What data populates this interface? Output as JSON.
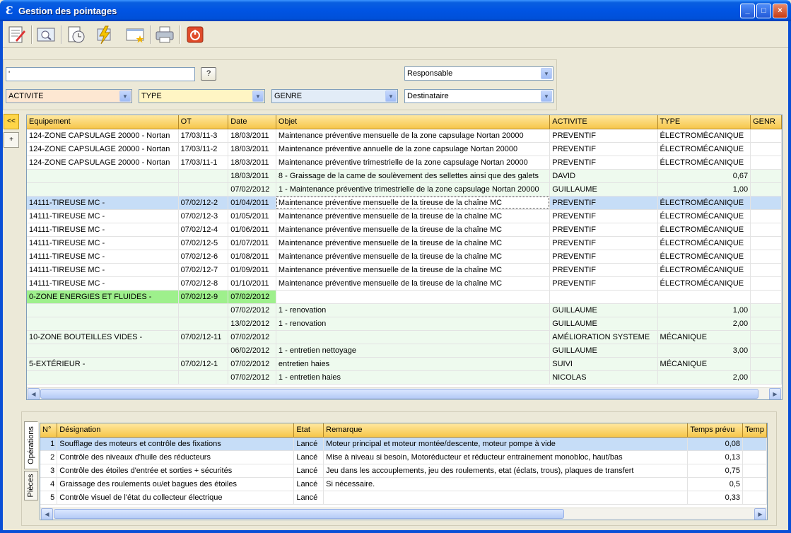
{
  "window": {
    "icon_glyph": "Ɛ",
    "title": "Gestion des pointages",
    "controls": [
      "_",
      "□",
      "×"
    ]
  },
  "toolbar": {
    "buttons": [
      {
        "name": "edit-document-icon"
      },
      {
        "name": "search-view-icon"
      },
      {
        "name": "schedule-clock-icon"
      },
      {
        "name": "lightning-icon"
      },
      {
        "name": "calendar-star-icon"
      },
      {
        "name": "print-icon"
      },
      {
        "name": "power-exit-icon"
      }
    ]
  },
  "filters": {
    "search_value": "'",
    "help_label": "?",
    "responsable": "Responsable",
    "activite": "ACTIVITE",
    "type": "TYPE",
    "genre": "GENRE",
    "destinataire": "Destinataire",
    "colors": {
      "activite": "#fde7d2",
      "type": "#fff5c4",
      "genre": "#e2ecf7"
    }
  },
  "nav": {
    "collapse_label": "<<",
    "add_label": "+"
  },
  "main_grid": {
    "columns": [
      "Equipement",
      "OT",
      "Date",
      "Objet",
      "ACTIVITE",
      "TYPE",
      "GENR"
    ],
    "rows": [
      {
        "equipement": "124-ZONE CAPSULAGE 20000 - Nortan",
        "ot": "17/03/11-3",
        "date": "18/03/2011",
        "objet": "Maintenance préventive mensuelle de la zone capsulage Nortan 20000",
        "activite": "PREVENTIF",
        "type": "ÉLECTROMÉCANIQUE",
        "genre": "",
        "style": ""
      },
      {
        "equipement": "124-ZONE CAPSULAGE 20000 - Nortan",
        "ot": "17/03/11-2",
        "date": "18/03/2011",
        "objet": "Maintenance préventive annuelle de la zone capsulage Nortan 20000",
        "activite": "PREVENTIF",
        "type": "ÉLECTROMÉCANIQUE",
        "genre": "",
        "style": ""
      },
      {
        "equipement": "124-ZONE CAPSULAGE 20000 - Nortan",
        "ot": "17/03/11-1",
        "date": "18/03/2011",
        "objet": "Maintenance préventive trimestrielle de la zone capsulage Nortan 20000",
        "activite": "PREVENTIF",
        "type": "ÉLECTROMÉCANIQUE",
        "genre": "",
        "style": ""
      },
      {
        "equipement": "",
        "ot": "",
        "date": "18/03/2011",
        "objet": "8 - Graissage de la came de soulèvement des sellettes ainsi que des galets",
        "activite": "DAVID",
        "type": "0,67",
        "genre": "",
        "style": "alt"
      },
      {
        "equipement": "",
        "ot": "",
        "date": "07/02/2012",
        "objet": "1 - Maintenance préventive trimestrielle de la zone capsulage Nortan 20000",
        "activite": "GUILLAUME",
        "type": "1,00",
        "genre": "",
        "style": "alt"
      },
      {
        "equipement": "14111-TIREUSE MC -",
        "ot": "07/02/12-2",
        "date": "01/04/2011",
        "objet": "Maintenance préventive mensuelle de la tireuse de la chaîne MC",
        "activite": "PREVENTIF",
        "type": "ÉLECTROMÉCANIQUE",
        "genre": "",
        "style": "sel"
      },
      {
        "equipement": "14111-TIREUSE MC -",
        "ot": "07/02/12-3",
        "date": "01/05/2011",
        "objet": "Maintenance préventive mensuelle de la tireuse de la chaîne MC",
        "activite": "PREVENTIF",
        "type": "ÉLECTROMÉCANIQUE",
        "genre": "",
        "style": ""
      },
      {
        "equipement": "14111-TIREUSE MC -",
        "ot": "07/02/12-4",
        "date": "01/06/2011",
        "objet": "Maintenance préventive mensuelle de la tireuse de la chaîne MC",
        "activite": "PREVENTIF",
        "type": "ÉLECTROMÉCANIQUE",
        "genre": "",
        "style": ""
      },
      {
        "equipement": "14111-TIREUSE MC -",
        "ot": "07/02/12-5",
        "date": "01/07/2011",
        "objet": "Maintenance préventive mensuelle de la tireuse de la chaîne MC",
        "activite": "PREVENTIF",
        "type": "ÉLECTROMÉCANIQUE",
        "genre": "",
        "style": ""
      },
      {
        "equipement": "14111-TIREUSE MC -",
        "ot": "07/02/12-6",
        "date": "01/08/2011",
        "objet": "Maintenance préventive mensuelle de la tireuse de la chaîne MC",
        "activite": "PREVENTIF",
        "type": "ÉLECTROMÉCANIQUE",
        "genre": "",
        "style": ""
      },
      {
        "equipement": "14111-TIREUSE MC -",
        "ot": "07/02/12-7",
        "date": "01/09/2011",
        "objet": "Maintenance préventive mensuelle de la tireuse de la chaîne MC",
        "activite": "PREVENTIF",
        "type": "ÉLECTROMÉCANIQUE",
        "genre": "",
        "style": ""
      },
      {
        "equipement": "14111-TIREUSE MC -",
        "ot": "07/02/12-8",
        "date": "01/10/2011",
        "objet": "Maintenance préventive mensuelle de la tireuse de la chaîne MC",
        "activite": "PREVENTIF",
        "type": "ÉLECTROMÉCANIQUE",
        "genre": "",
        "style": ""
      },
      {
        "equipement": "0-ZONE ENERGIES ET FLUIDES -",
        "ot": "07/02/12-9",
        "date": "07/02/2012",
        "objet": "",
        "activite": "",
        "type": "",
        "genre": "",
        "style": "green"
      },
      {
        "equipement": "",
        "ot": "",
        "date": "07/02/2012",
        "objet": "1 - renovation",
        "activite": "GUILLAUME",
        "type": "1,00",
        "genre": "",
        "style": "alt"
      },
      {
        "equipement": "",
        "ot": "",
        "date": "13/02/2012",
        "objet": "1 - renovation",
        "activite": "GUILLAUME",
        "type": "2,00",
        "genre": "",
        "style": "alt"
      },
      {
        "equipement": "10-ZONE BOUTEILLES VIDES -",
        "ot": "07/02/12-11",
        "date": "07/02/2012",
        "objet": "",
        "activite": "AMÉLIORATION SYSTEME",
        "type": "MÉCANIQUE",
        "genre": "",
        "style": "alt"
      },
      {
        "equipement": "",
        "ot": "",
        "date": "06/02/2012",
        "objet": "1 - entretien nettoyage",
        "activite": "GUILLAUME",
        "type": "3,00",
        "genre": "",
        "style": "alt"
      },
      {
        "equipement": "5-EXTÉRIEUR -",
        "ot": "07/02/12-1",
        "date": "07/02/2012",
        "objet": "entretien haies",
        "activite": "SUIVI",
        "type": "MÉCANIQUE",
        "genre": "",
        "style": "alt"
      },
      {
        "equipement": "",
        "ot": "",
        "date": "07/02/2012",
        "objet": "1 - entretien haies",
        "activite": "NICOLAS",
        "type": "2,00",
        "genre": "",
        "style": "alt"
      }
    ]
  },
  "bottom": {
    "tabs": [
      {
        "label": "Opérations",
        "active": true
      },
      {
        "label": "Pièces",
        "active": false
      }
    ],
    "columns": [
      "N°",
      "Désignation",
      "Etat",
      "Remarque",
      "Temps prévu",
      "Temp"
    ],
    "rows": [
      {
        "n": "1",
        "designation": "Soufflage des moteurs et contrôle des fixations",
        "etat": "Lancé",
        "remarque": "Moteur principal et moteur montée/descente, moteur pompe à vide",
        "temps": "0,08",
        "sel": true
      },
      {
        "n": "2",
        "designation": "Contrôle des niveaux d'huile des réducteurs",
        "etat": "Lancé",
        "remarque": "Mise à niveau si besoin, Motoréducteur et réducteur entrainement monobloc, haut/bas",
        "temps": "0,13",
        "sel": false
      },
      {
        "n": "3",
        "designation": "Contrôle des étoiles d'entrée et sorties + sécurités",
        "etat": "Lancé",
        "remarque": "Jeu dans les accouplements, jeu des roulements, etat (éclats, trous), plaques de transfert",
        "temps": "0,75",
        "sel": false
      },
      {
        "n": "4",
        "designation": "Graissage des roulements ou/et bagues des étoiles",
        "etat": "Lancé",
        "remarque": "Si nécessaire.",
        "temps": "0,5",
        "sel": false
      },
      {
        "n": "5",
        "designation": "Contrôle visuel de l'état du collecteur électrique",
        "etat": "Lancé",
        "remarque": "",
        "temps": "0,33",
        "sel": false
      }
    ]
  }
}
